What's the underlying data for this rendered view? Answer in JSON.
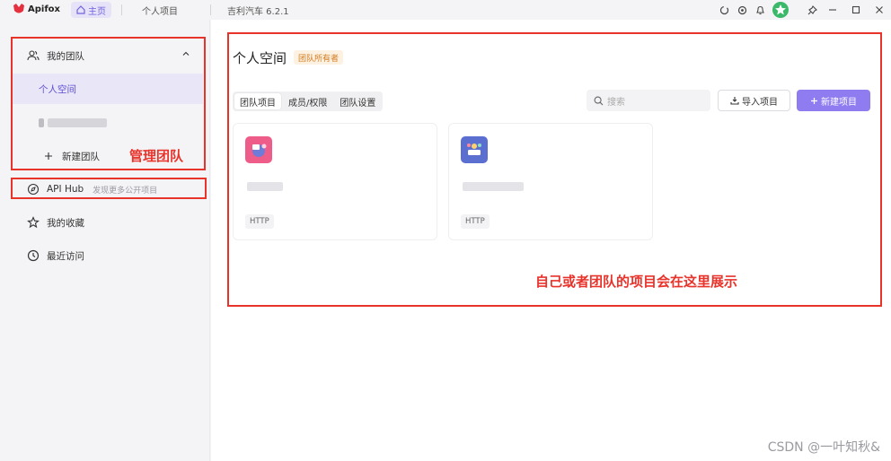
{
  "app": {
    "name": "Apifox",
    "tabs": [
      {
        "label": "主页"
      },
      {
        "label": "个人项目"
      },
      {
        "label": "吉利汽车 6.2.1"
      }
    ]
  },
  "sidebar": {
    "team_group": {
      "label": "我的团队"
    },
    "items": [
      {
        "label": "个人空间"
      },
      {
        "label": "新建团队"
      }
    ],
    "api_hub": {
      "label": "API Hub",
      "hint": "发现更多公开项目"
    },
    "favorites": {
      "label": "我的收藏"
    },
    "recent": {
      "label": "最近访问"
    }
  },
  "annotations": {
    "manage_team": "管理团队",
    "projects_here": "自己或者团队的项目会在这里展示"
  },
  "main": {
    "title": "个人空间",
    "owner_badge": "团队所有者",
    "tabs": [
      {
        "label": "团队项目"
      },
      {
        "label": "成员/权限"
      },
      {
        "label": "团队设置"
      }
    ],
    "search_placeholder": "搜索",
    "import_label": "导入项目",
    "new_label": "新建项目",
    "projects": [
      {
        "tag": "HTTP"
      },
      {
        "tag": "HTTP"
      }
    ]
  },
  "watermark": "CSDN @一叶知秋&",
  "colors": {
    "accent": "#8f7cf0",
    "annotation_red": "#e8332b",
    "active_bg": "#e9e6f8"
  }
}
